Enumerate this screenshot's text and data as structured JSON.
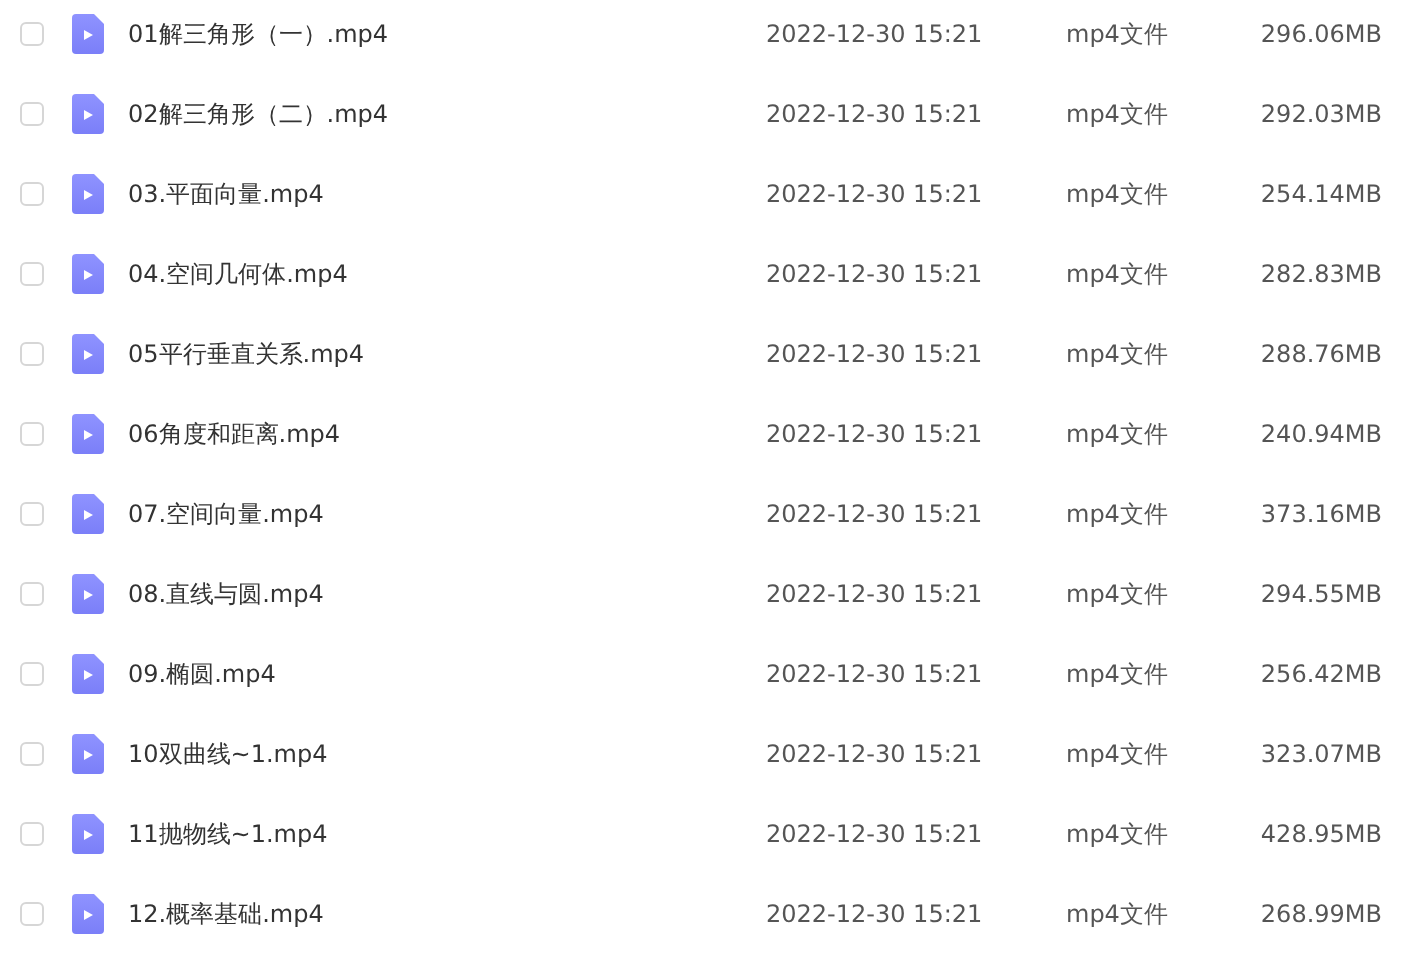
{
  "files": [
    {
      "name": "01解三角形（一）.mp4",
      "modified": "2022-12-30 15:21",
      "type": "mp4文件",
      "size": "296.06MB",
      "checked": false
    },
    {
      "name": "02解三角形（二）.mp4",
      "modified": "2022-12-30 15:21",
      "type": "mp4文件",
      "size": "292.03MB",
      "checked": false
    },
    {
      "name": "03.平面向量.mp4",
      "modified": "2022-12-30 15:21",
      "type": "mp4文件",
      "size": "254.14MB",
      "checked": false
    },
    {
      "name": "04.空间几何体.mp4",
      "modified": "2022-12-30 15:21",
      "type": "mp4文件",
      "size": "282.83MB",
      "checked": false
    },
    {
      "name": "05平行垂直关系.mp4",
      "modified": "2022-12-30 15:21",
      "type": "mp4文件",
      "size": "288.76MB",
      "checked": false
    },
    {
      "name": "06角度和距离.mp4",
      "modified": "2022-12-30 15:21",
      "type": "mp4文件",
      "size": "240.94MB",
      "checked": false
    },
    {
      "name": "07.空间向量.mp4",
      "modified": "2022-12-30 15:21",
      "type": "mp4文件",
      "size": "373.16MB",
      "checked": false
    },
    {
      "name": "08.直线与圆.mp4",
      "modified": "2022-12-30 15:21",
      "type": "mp4文件",
      "size": "294.55MB",
      "checked": false
    },
    {
      "name": "09.椭圆.mp4",
      "modified": "2022-12-30 15:21",
      "type": "mp4文件",
      "size": "256.42MB",
      "checked": false
    },
    {
      "name": "10双曲线~1.mp4",
      "modified": "2022-12-30 15:21",
      "type": "mp4文件",
      "size": "323.07MB",
      "checked": false
    },
    {
      "name": "11抛物线~1.mp4",
      "modified": "2022-12-30 15:21",
      "type": "mp4文件",
      "size": "428.95MB",
      "checked": false
    },
    {
      "name": "12.概率基础.mp4",
      "modified": "2022-12-30 15:21",
      "type": "mp4文件",
      "size": "268.99MB",
      "checked": false
    }
  ]
}
